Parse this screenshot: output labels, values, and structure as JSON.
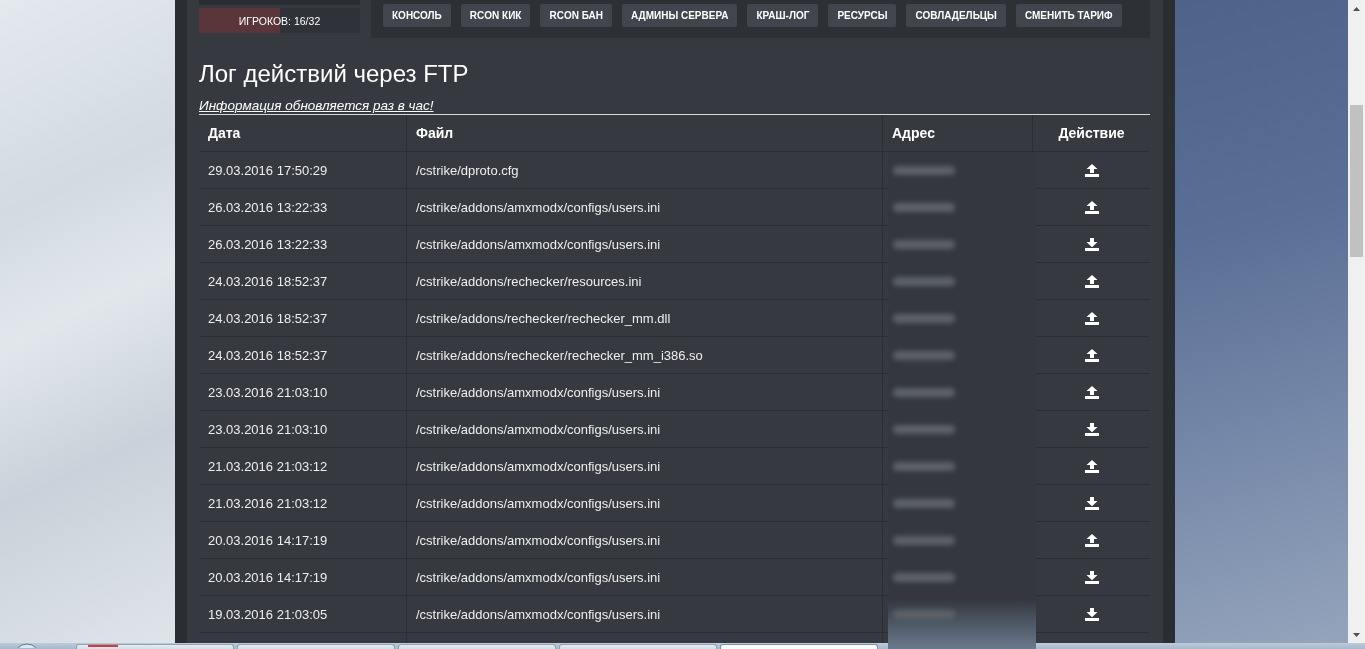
{
  "top_panel": {
    "players": {
      "label": "ИГРОКОВ: 16/32",
      "level": 0.5
    }
  },
  "toolbar": {
    "buttons": [
      "КОНСОЛЬ",
      "RCON КИК",
      "RCON БАН",
      "АДМИНЫ СЕРВЕРА",
      "КРАШ-ЛОГ",
      "РЕСУРСЫ",
      "СОВЛАДЕЛЬЦЫ",
      "СМЕНИТЬ ТАРИФ"
    ]
  },
  "page": {
    "title": "Лог действий через FTP",
    "note": "Информация обновляется раз в час!"
  },
  "table": {
    "columns": [
      "Дата",
      "Файл",
      "Адрес",
      "Действие"
    ],
    "rows": [
      {
        "date": "29.03.2016 17:50:29",
        "file": "/cstrike/dproto.cfg",
        "kind": "upload"
      },
      {
        "date": "26.03.2016 13:22:33",
        "file": "/cstrike/addons/amxmodx/configs/users.ini",
        "kind": "upload"
      },
      {
        "date": "26.03.2016 13:22:33",
        "file": "/cstrike/addons/amxmodx/configs/users.ini",
        "kind": "download"
      },
      {
        "date": "24.03.2016 18:52:37",
        "file": "/cstrike/addons/rechecker/resources.ini",
        "kind": "upload"
      },
      {
        "date": "24.03.2016 18:52:37",
        "file": "/cstrike/addons/rechecker/rechecker_mm.dll",
        "kind": "upload"
      },
      {
        "date": "24.03.2016 18:52:37",
        "file": "/cstrike/addons/rechecker/rechecker_mm_i386.so",
        "kind": "upload"
      },
      {
        "date": "23.03.2016 21:03:10",
        "file": "/cstrike/addons/amxmodx/configs/users.ini",
        "kind": "upload"
      },
      {
        "date": "23.03.2016 21:03:10",
        "file": "/cstrike/addons/amxmodx/configs/users.ini",
        "kind": "download"
      },
      {
        "date": "21.03.2016 21:03:12",
        "file": "/cstrike/addons/amxmodx/configs/users.ini",
        "kind": "upload"
      },
      {
        "date": "21.03.2016 21:03:12",
        "file": "/cstrike/addons/amxmodx/configs/users.ini",
        "kind": "download"
      },
      {
        "date": "20.03.2016 14:17:19",
        "file": "/cstrike/addons/amxmodx/configs/users.ini",
        "kind": "upload"
      },
      {
        "date": "20.03.2016 14:17:19",
        "file": "/cstrike/addons/amxmodx/configs/users.ini",
        "kind": "download"
      },
      {
        "date": "19.03.2016 21:03:05",
        "file": "/cstrike/addons/amxmodx/configs/users.ini",
        "kind": "download"
      }
    ]
  },
  "taskbar": {
    "buttons": [
      {
        "selected": false
      },
      {
        "selected": false
      },
      {
        "selected": false
      },
      {
        "selected": false
      },
      {
        "selected": true
      }
    ]
  }
}
